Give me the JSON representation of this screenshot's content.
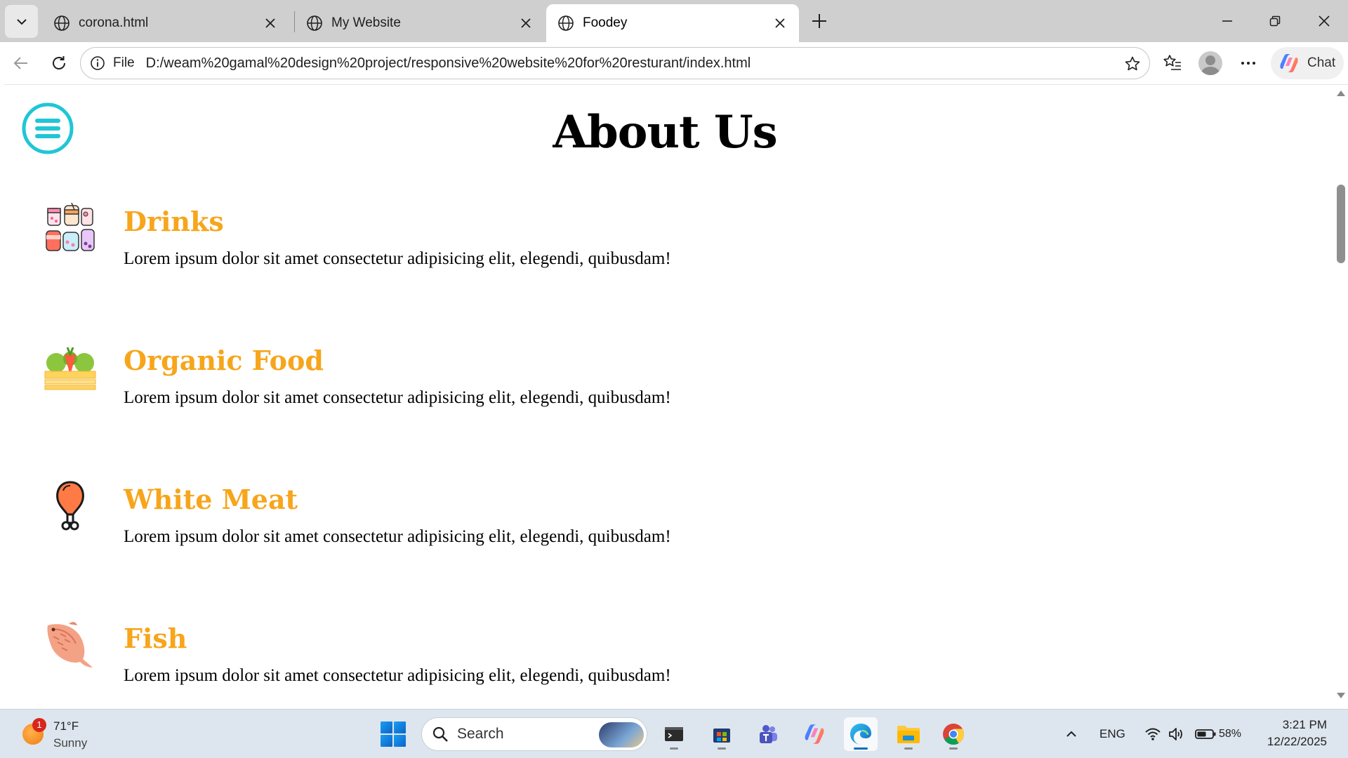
{
  "browser": {
    "tabs": [
      {
        "title": "corona.html",
        "active": false
      },
      {
        "title": "My Website",
        "active": false
      },
      {
        "title": "Foodey",
        "active": true
      }
    ],
    "address": {
      "scheme": "File",
      "url": "D:/weam%20gamal%20design%20project/responsive%20website%20for%20resturant/index.html"
    },
    "chat_label": "Chat"
  },
  "page": {
    "title": "About Us",
    "items": [
      {
        "title": "Drinks",
        "description": "Lorem ipsum dolor sit amet consectetur adipisicing elit, elegendi, quibusdam!",
        "icon": "drinks-icon"
      },
      {
        "title": "Organic Food",
        "description": "Lorem ipsum dolor sit amet consectetur adipisicing elit, elegendi, quibusdam!",
        "icon": "organic-food-icon"
      },
      {
        "title": "White Meat",
        "description": "Lorem ipsum dolor sit amet consectetur adipisicing elit, elegendi, quibusdam!",
        "icon": "chicken-leg-icon"
      },
      {
        "title": "Fish",
        "description": "Lorem ipsum dolor sit amet consectetur adipisicing elit, elegendi, quibusdam!",
        "icon": "fish-icon"
      }
    ],
    "colors": {
      "heading_accent": "#f7a51b",
      "menu_button": "#1fc6d6"
    }
  },
  "taskbar": {
    "weather": {
      "temp": "71°F",
      "condition": "Sunny",
      "badge": "1"
    },
    "search_label": "Search",
    "tray": {
      "language": "ENG",
      "battery": "58%"
    },
    "clock": {
      "time": "3:21 PM",
      "date": "12/22/2025"
    }
  }
}
